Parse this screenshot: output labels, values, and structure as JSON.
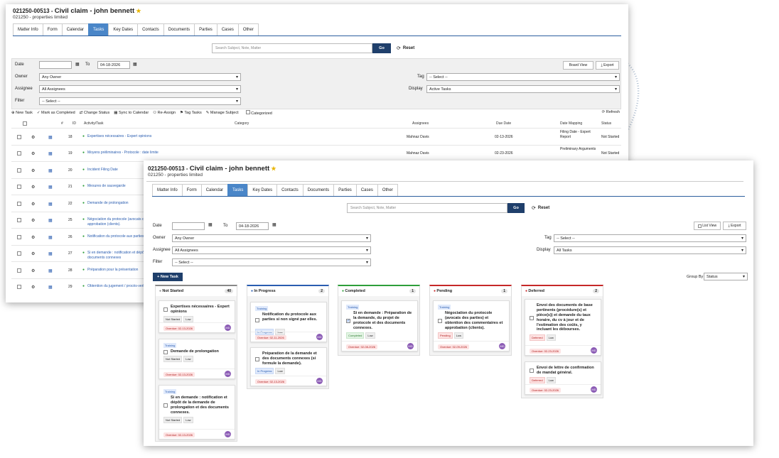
{
  "matter": {
    "id": "021250-00513",
    "name": "Civil claim - john bennett",
    "client": "021250 - properties limited"
  },
  "tabs": [
    "Matter Info",
    "Form",
    "Calendar",
    "Tasks",
    "Key Dates",
    "Contacts",
    "Documents",
    "Parties",
    "Cases",
    "Other"
  ],
  "search": {
    "placeholder": "Search Subject, Note, Matter",
    "go_label": "Go",
    "reset_label": "Reset"
  },
  "filters": {
    "date_label": "Date",
    "to_label": "To",
    "to_date": "04-18-2026",
    "owner_label": "Owner",
    "owner_value": "Any Owner",
    "assignee_label": "Assignee",
    "assignee_value": "All Assignees",
    "filter_label": "Filter",
    "filter_value": "-- Select --",
    "tag_label": "Tag",
    "tag_value": "-- Select --",
    "display_label": "Display"
  },
  "back": {
    "display_value": "Active Tasks",
    "board_view_label": "Board View",
    "export_label": "Export",
    "toolbar": {
      "new_task": "New Task",
      "mark_completed": "Mark as Completed",
      "change_status": "Change Status",
      "sync_calendar": "Sync to Calendar",
      "reassign": "Re-Assign",
      "tag_tasks": "Tag Tasks",
      "manage_subject": "Manage Subject",
      "categorized": "Categorized",
      "refresh": "Refresh"
    },
    "columns": [
      "#",
      "ID",
      "Activity/Task",
      "Category",
      "Assignees",
      "Due Date",
      "Date Mapping",
      "Status"
    ],
    "rows": [
      {
        "id": "18",
        "task": "Expertises nécessaires - Expert opinions",
        "assignee": "Mahnaz Davis",
        "due": "02-13-2026",
        "mapping": "Filing Date - Expert Report",
        "status": "Not Started"
      },
      {
        "id": "19",
        "task": "Moyens préliminaires - Protocole : date limite",
        "assignee": "Mahnaz Davis",
        "due": "02-23-2026",
        "mapping": "Preliminary Arguments",
        "status": "Not Started"
      },
      {
        "id": "20",
        "task": "Incident Filing Date"
      },
      {
        "id": "21",
        "task": "Mesures de sauvegarde"
      },
      {
        "id": "22",
        "task": "Demande de prolongation"
      },
      {
        "id": "25",
        "task": "Négociation du protocole (avocats de et approbation (clients)."
      },
      {
        "id": "26",
        "task": "Notification du protocole aux parties"
      },
      {
        "id": "27",
        "task": "Si en demande : notification et dépôt documents connexes"
      },
      {
        "id": "28",
        "task": "Préparation pour la présentation"
      },
      {
        "id": "29",
        "task": "Obtention du jugement / procès-verb"
      }
    ]
  },
  "front": {
    "display_value": "All Tasks",
    "list_view_label": "List View",
    "export_label": "Export",
    "new_task_label": "New Task",
    "group_by_label": "Group By",
    "group_by_value": "Status",
    "board": [
      {
        "name": "Not Started",
        "count": "40",
        "color": "#888888",
        "cards": [
          {
            "tag": "",
            "title": "Expertises nécessaires - Expert opinions",
            "status": "Not Started",
            "priority": "Low",
            "overdue": "Overdue: 02-13-2026",
            "avatar": "MD"
          },
          {
            "tag": "Training",
            "title": "Demande de prolongation",
            "status": "Not Started",
            "priority": "Low",
            "overdue": "Overdue: 02-13-2026",
            "avatar": "MD"
          },
          {
            "tag": "Training",
            "title": "Si en demande : notification et dépôt de la demande de prolongation et des documents connexes.",
            "status": "Not Started",
            "priority": "Low",
            "overdue": "Overdue: 02-13-2026",
            "avatar": "MD"
          }
        ]
      },
      {
        "name": "In Progress",
        "count": "2",
        "color": "#2a5db0",
        "cards": [
          {
            "tag": "Training",
            "title": "Notification du protocole aux parties si non signé par elles.",
            "status": "In Progress",
            "priority": "Low",
            "overdue": "Overdue: 02-11-2026",
            "avatar": "MD"
          },
          {
            "tag": "",
            "title": "Préparation de la demande et des documents connexes (si formule la demande).",
            "status": "In Progress",
            "priority": "Low",
            "overdue": "Overdue: 02-13-2026",
            "avatar": "MD"
          }
        ]
      },
      {
        "name": "Completed",
        "count": "1",
        "color": "#2e9e3a",
        "cards": [
          {
            "tag": "Training",
            "title": "Si en demande : Préparation de la demande, du projet de protocole et des documents connexes.",
            "status": "Completed",
            "priority": "Low",
            "overdue": "Overdue: 02-08-2026",
            "avatar": "MD"
          }
        ]
      },
      {
        "name": "Pending",
        "count": "1",
        "color": "#c62828",
        "cards": [
          {
            "tag": "Training",
            "title": "Négociation du protocole (avocats des parties) et obtention des commentaires et approbation (clients).",
            "status": "Pending",
            "priority": "Low",
            "overdue": "Overdue: 02-09-2026",
            "avatar": "MD"
          }
        ]
      },
      {
        "name": "Deferred",
        "count": "2",
        "color": "#c62828",
        "cards": [
          {
            "tag": "",
            "title": "Envoi des documents de base pertinents (procédure(s) et pièce(s)) et demande du taux horaire, du cv à jour et de l'estimation des coûts, y incluant les débourses.",
            "status": "Deferred",
            "priority": "Low",
            "overdue": "Overdue: 02-23-2026",
            "avatar": "MD"
          },
          {
            "tag": "",
            "title": "Envoi de lettre de confirmation de mandat général.",
            "status": "Deferred",
            "priority": "Low",
            "overdue": "Overdue: 02-23-2026",
            "avatar": "MD"
          }
        ]
      }
    ]
  },
  "icons": {
    "star": "star-icon",
    "calendar": "calendar-icon",
    "refresh": "refresh-icon",
    "export": "export-icon",
    "avatar": "avatar-icon"
  }
}
